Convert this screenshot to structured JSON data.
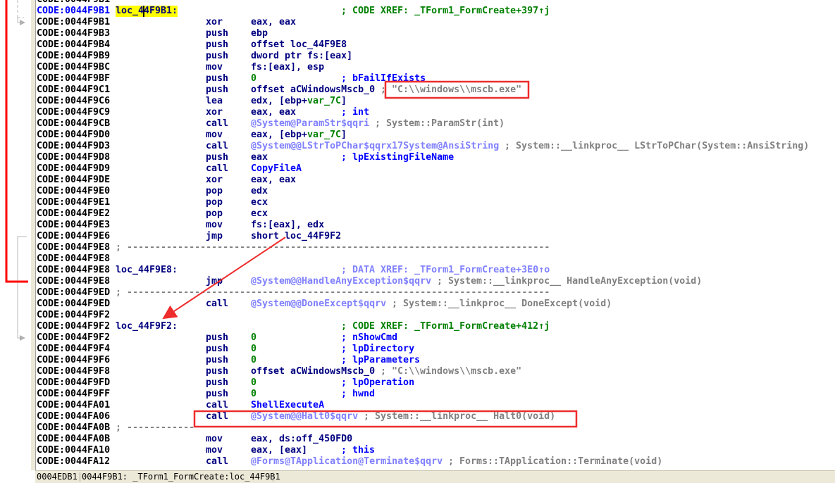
{
  "colors": {
    "address_current": "#0000ff",
    "mnemonic": "#000080",
    "number": "#008000",
    "comment_auto": "#0000ff",
    "import_name": "#8080ff",
    "comment_gray": "#808080",
    "label_highlight": "#ffff00",
    "annotation_red": "#ee2c2c",
    "breakpoint_dot": "#5ac8f5"
  },
  "rows": [
    {
      "addr": "CODE:0044F9B1"
    },
    {
      "addr": "CODE:0044F9B1",
      "current": true,
      "label": "loc_44F9B1:",
      "comment": [
        [
          "; CODE XREF: _TForm1_FormCreate+397↑j",
          "g"
        ]
      ]
    },
    {
      "addr": "CODE:0044F9B1",
      "mn": "xor",
      "ops": [
        [
          "eax, eax",
          "n"
        ]
      ]
    },
    {
      "addr": "CODE:0044F9B3",
      "mn": "push",
      "ops": [
        [
          "ebp",
          "n"
        ]
      ]
    },
    {
      "addr": "CODE:0044F9B4",
      "mn": "push",
      "ops": [
        [
          "offset loc_44F9E8",
          "n"
        ]
      ]
    },
    {
      "addr": "CODE:0044F9B9",
      "mn": "push",
      "ops": [
        [
          "dword ptr fs:[eax]",
          "n"
        ]
      ]
    },
    {
      "addr": "CODE:0044F9BC",
      "mn": "mov",
      "ops": [
        [
          "fs:[eax], esp",
          "n"
        ]
      ]
    },
    {
      "addr": "CODE:0044F9BF",
      "mn": "push",
      "ops": [
        [
          "0",
          "g"
        ]
      ],
      "comment": [
        [
          "; bFailIfExists",
          "b"
        ]
      ]
    },
    {
      "addr": "CODE:0044F9C1",
      "mn": "push",
      "ops": [
        [
          "offset aCWindowsMscb_0",
          "n"
        ]
      ],
      "comment": [
        [
          "; \"C:\\\\windows\\\\mscb.exe\"",
          "x"
        ]
      ]
    },
    {
      "addr": "CODE:0044F9C6",
      "mn": "lea",
      "ops": [
        [
          "edx, [ebp+",
          "n"
        ],
        [
          "var_7C",
          "g"
        ],
        [
          "]",
          "n"
        ]
      ]
    },
    {
      "addr": "CODE:0044F9C9",
      "mn": "xor",
      "ops": [
        [
          "eax, eax",
          "n"
        ]
      ],
      "comment": [
        [
          "; int",
          "b"
        ]
      ]
    },
    {
      "addr": "CODE:0044F9CB",
      "mn": "call",
      "ops": [
        [
          "@System@ParamStr$qqri",
          "l"
        ]
      ],
      "comment": [
        [
          "; System::ParamStr(int)",
          "x"
        ]
      ]
    },
    {
      "addr": "CODE:0044F9D0",
      "mn": "mov",
      "ops": [
        [
          "eax, [ebp+",
          "n"
        ],
        [
          "var_7C",
          "g"
        ],
        [
          "]",
          "n"
        ]
      ]
    },
    {
      "addr": "CODE:0044F9D3",
      "mn": "call",
      "ops": [
        [
          "@System@@LStrToPChar$qqrx17System@AnsiString",
          "l"
        ]
      ],
      "comment": [
        [
          "; System::__linkproc__ LStrToPChar(System::AnsiString)",
          "x"
        ]
      ]
    },
    {
      "addr": "CODE:0044F9D8",
      "mn": "push",
      "ops": [
        [
          "eax",
          "n"
        ]
      ],
      "comment": [
        [
          "; lpExistingFileName",
          "b"
        ]
      ]
    },
    {
      "addr": "CODE:0044F9D9",
      "mn": "call",
      "ops": [
        [
          "CopyFileA",
          "b"
        ]
      ]
    },
    {
      "addr": "CODE:0044F9DE",
      "mn": "xor",
      "ops": [
        [
          "eax, eax",
          "n"
        ]
      ]
    },
    {
      "addr": "CODE:0044F9E0",
      "mn": "pop",
      "ops": [
        [
          "edx",
          "n"
        ]
      ]
    },
    {
      "addr": "CODE:0044F9E1",
      "mn": "pop",
      "ops": [
        [
          "ecx",
          "n"
        ]
      ]
    },
    {
      "addr": "CODE:0044F9E2",
      "mn": "pop",
      "ops": [
        [
          "ecx",
          "n"
        ]
      ]
    },
    {
      "addr": "CODE:0044F9E3",
      "mn": "mov",
      "ops": [
        [
          "fs:[eax], edx",
          "n"
        ]
      ]
    },
    {
      "addr": "CODE:0044F9E6",
      "mn": "jmp",
      "ops": [
        [
          "short loc_44F9F2",
          "n"
        ]
      ]
    },
    {
      "addr": "CODE:0044F9E8",
      "sep": "; ---------------------------------------------------------------------------"
    },
    {
      "addr": "CODE:0044F9E8"
    },
    {
      "addr": "CODE:0044F9E8",
      "label": "loc_44F9E8:",
      "comment": [
        [
          "; DATA XREF: _TForm1_FormCreate+3E0↑o",
          "l"
        ]
      ]
    },
    {
      "addr": "CODE:0044F9E8",
      "mn": "jmp",
      "ops": [
        [
          "@System@@HandleAnyException$qqrv",
          "l"
        ]
      ],
      "comment": [
        [
          "; System::__linkproc__ HandleAnyException(void)",
          "x"
        ]
      ]
    },
    {
      "addr": "CODE:0044F9ED",
      "sep": "; ---------------------------------------------------------------------------"
    },
    {
      "addr": "CODE:0044F9ED",
      "mn": "call",
      "ops": [
        [
          "@System@@DoneExcept$qqrv",
          "l"
        ]
      ],
      "comment": [
        [
          "; System::__linkproc__ DoneExcept(void)",
          "x"
        ]
      ]
    },
    {
      "addr": "CODE:0044F9F2"
    },
    {
      "addr": "CODE:0044F9F2",
      "label": "loc_44F9F2:",
      "comment": [
        [
          "; CODE XREF: _TForm1_FormCreate+412↑j",
          "g"
        ]
      ]
    },
    {
      "addr": "CODE:0044F9F2",
      "mn": "push",
      "ops": [
        [
          "0",
          "g"
        ]
      ],
      "comment": [
        [
          "; nShowCmd",
          "b"
        ]
      ]
    },
    {
      "addr": "CODE:0044F9F4",
      "mn": "push",
      "ops": [
        [
          "0",
          "g"
        ]
      ],
      "comment": [
        [
          "; lpDirectory",
          "b"
        ]
      ]
    },
    {
      "addr": "CODE:0044F9F6",
      "mn": "push",
      "ops": [
        [
          "0",
          "g"
        ]
      ],
      "comment": [
        [
          "; lpParameters",
          "b"
        ]
      ]
    },
    {
      "addr": "CODE:0044F9F8",
      "mn": "push",
      "ops": [
        [
          "offset aCWindowsMscb_0",
          "n"
        ]
      ],
      "comment": [
        [
          "; \"C:\\\\windows\\\\mscb.exe\"",
          "x"
        ]
      ]
    },
    {
      "addr": "CODE:0044F9FD",
      "mn": "push",
      "ops": [
        [
          "0",
          "g"
        ]
      ],
      "comment": [
        [
          "; lpOperation",
          "b"
        ]
      ]
    },
    {
      "addr": "CODE:0044F9FF",
      "mn": "push",
      "ops": [
        [
          "0",
          "g"
        ]
      ],
      "comment": [
        [
          "; hwnd",
          "b"
        ]
      ]
    },
    {
      "addr": "CODE:0044FA01",
      "mn": "call",
      "ops": [
        [
          "ShellExecuteA",
          "b"
        ]
      ]
    },
    {
      "addr": "CODE:0044FA06",
      "mn": "call",
      "ops": [
        [
          "@System@@Halt0$qqrv",
          "l"
        ]
      ],
      "comment": [
        [
          "; System::__linkproc__ Halt0(void)",
          "x"
        ]
      ]
    },
    {
      "addr": "CODE:0044FA0B",
      "sep": "; ------------"
    },
    {
      "addr": "CODE:0044FA0B",
      "mn": "mov",
      "ops": [
        [
          "eax, ds:off_450FD0",
          "n"
        ]
      ]
    },
    {
      "addr": "CODE:0044FA10",
      "mn": "mov",
      "ops": [
        [
          "eax, [eax]",
          "n"
        ]
      ],
      "comment": [
        [
          "; this",
          "b"
        ]
      ]
    },
    {
      "addr": "CODE:0044FA12",
      "mn": "call",
      "ops": [
        [
          "@Forms@TApplication@Terminate$qqrv",
          "l"
        ]
      ],
      "comment": [
        [
          "; Forms::TApplication::Terminate(void)",
          "x"
        ]
      ]
    }
  ],
  "statusbar": {
    "file_offset": "0004EDB1",
    "location": "0044F9B1: _TForm1_FormCreate:loc_44F9B1"
  }
}
